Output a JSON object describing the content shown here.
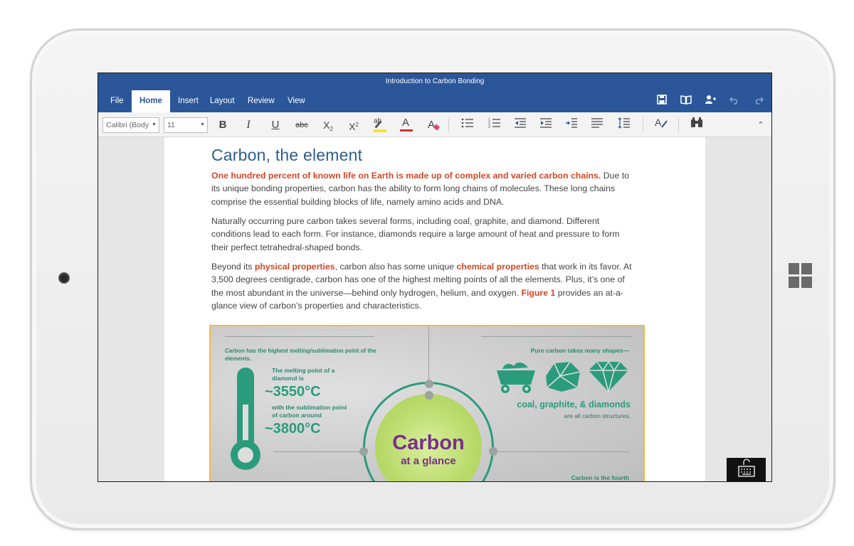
{
  "app": {
    "window_title": "Introduction to Carbon Bonding"
  },
  "tabs": [
    {
      "label": "File",
      "active": false
    },
    {
      "label": "Home",
      "active": true
    },
    {
      "label": "Insert",
      "active": false
    },
    {
      "label": "Layout",
      "active": false
    },
    {
      "label": "Review",
      "active": false
    },
    {
      "label": "View",
      "active": false
    }
  ],
  "quick_access": [
    "save-icon",
    "reading-view-icon",
    "share-icon",
    "undo-icon",
    "redo-icon"
  ],
  "ribbon": {
    "font_name": "Calibri (Body",
    "font_size": "11",
    "bold": "B",
    "italic": "I",
    "underline": "U",
    "strikethrough": "abc",
    "subscript": "X",
    "subscript_small": "2",
    "superscript": "X",
    "superscript_small": "2",
    "highlight": "ab",
    "font_color": "A",
    "clear_format": "A"
  },
  "document": {
    "heading": "Carbon, the element",
    "p1_highlight": "One hundred percent of known life on Earth is made up of complex and varied carbon chains.",
    "p1_rest": " Due to its unique bonding properties, carbon has the ability to form long chains of molecules. These long chains comprise the essential building blocks of life, namely amino acids and DNA.",
    "p2": "Naturally occurring pure carbon takes several forms, including coal, graphite, and diamond. Different conditions lead to each form. For instance, diamonds require a large amount of heat and pressure to form their perfect tetrahedral-shaped bonds.",
    "p3_a": "Beyond its ",
    "p3_physical": "physical properties",
    "p3_b": ", carbon also has some unique ",
    "p3_chemical": "chemical properties",
    "p3_c": " that work in its favor. At 3,500 degrees centigrade, carbon has one of the highest melting points of all the elements. Plus, it’s one of the most abundant in the universe—behind only hydrogen, helium, and oxygen. ",
    "p3_figure": "Figure 1",
    "p3_d": " provides an at-a-glance view of carbon’s properties and characteristics."
  },
  "figure": {
    "melting_caption": "Carbon has the highest melting/sublimation point of the elements.",
    "diamond_label": "The melting point of a diamond is",
    "diamond_value": "~3550°C",
    "sublimation_label": "with the sublimation point of carbon around",
    "sublimation_value": "~3800°C",
    "shapes_caption": "Pure carbon takes many shapes—",
    "forms": "coal, graphite, & diamonds",
    "forms_sub": "are all carbon structures.",
    "center_title": "Carbon",
    "center_sub": "at a glance",
    "fourth_caption": "Carbon is the fourth"
  },
  "colors": {
    "brand_blue": "#2b579a",
    "accent_orange": "#d24726",
    "figure_green": "#2a9c7c",
    "carbon_purple": "#7a2e8e"
  }
}
